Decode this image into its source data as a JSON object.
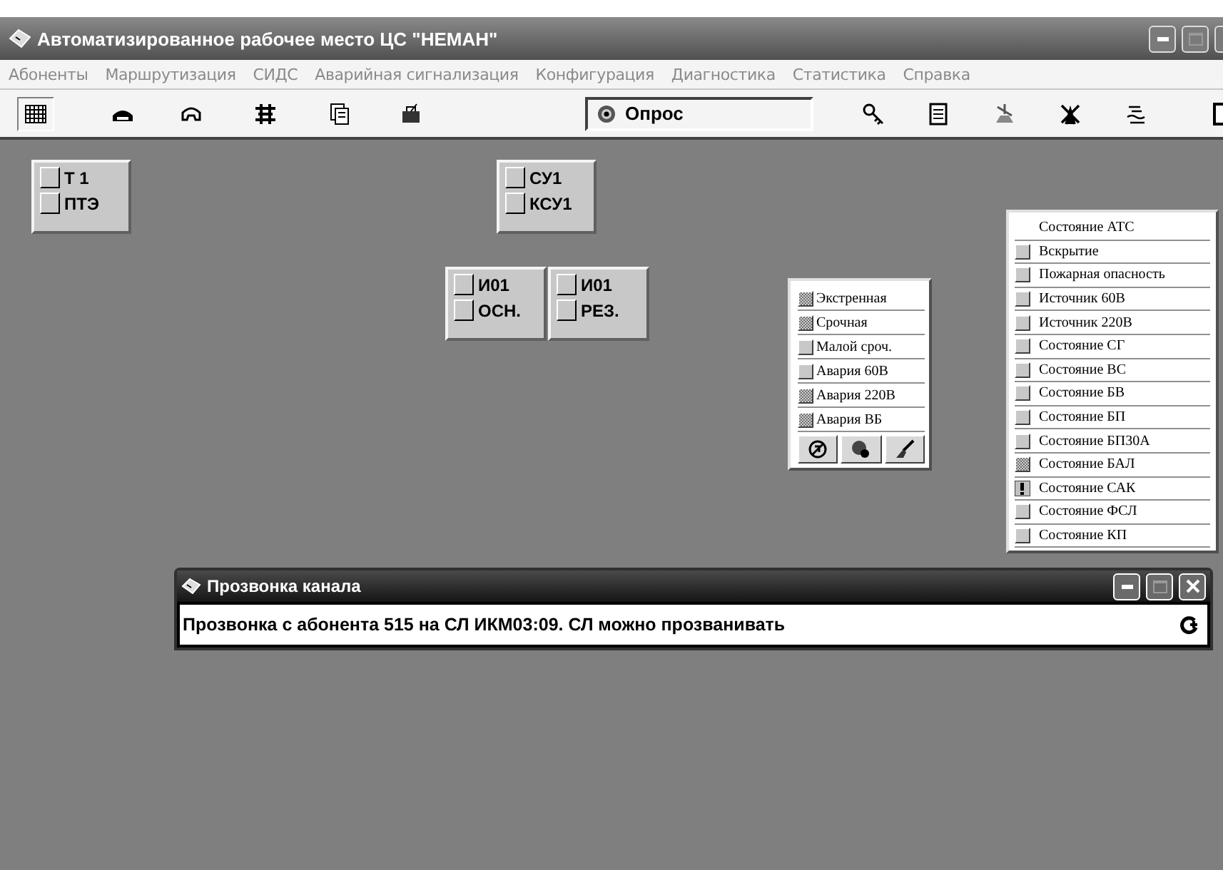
{
  "window": {
    "title": "Автоматизированное рабочее место ЦС \"НЕМАН\""
  },
  "menu": [
    "Абоненты",
    "Маршрутизация",
    "СИДС",
    "Аварийная сигнализация",
    "Конфигурация",
    "Диагностика",
    "Статистика",
    "Справка"
  ],
  "toolbar": {
    "poll_field": "Опрос"
  },
  "nodes": [
    {
      "lines": [
        "Т 1",
        "ПТЭ"
      ]
    },
    {
      "lines": [
        "СУ1",
        "КСУ1"
      ]
    },
    {
      "lines": [
        "И01",
        "ОСН."
      ]
    },
    {
      "lines": [
        "И01",
        "РЕЗ."
      ]
    }
  ],
  "alarm_panel": {
    "items": [
      {
        "label": "Экстренная",
        "kind": "pattern"
      },
      {
        "label": "Срочная",
        "kind": "pattern"
      },
      {
        "label": "Малой сроч.",
        "kind": "normal"
      },
      {
        "label": "Авария 60В",
        "kind": "normal"
      },
      {
        "label": "Авария 220В",
        "kind": "pattern"
      },
      {
        "label": "Авария ВБ",
        "kind": "pattern"
      }
    ]
  },
  "status_list": {
    "items": [
      {
        "label": "Состояние АТС",
        "kind": "none"
      },
      {
        "label": "Вскрытие",
        "kind": "normal"
      },
      {
        "label": "Пожарная опасность",
        "kind": "normal"
      },
      {
        "label": "Источник 60В",
        "kind": "normal"
      },
      {
        "label": "Источник 220В",
        "kind": "normal"
      },
      {
        "label": "Состояние СГ",
        "kind": "normal"
      },
      {
        "label": "Состояние ВС",
        "kind": "normal"
      },
      {
        "label": "Состояние БВ",
        "kind": "normal"
      },
      {
        "label": "Состояние БП",
        "kind": "normal"
      },
      {
        "label": "Состояние БП30А",
        "kind": "normal"
      },
      {
        "label": "Состояние БАЛ",
        "kind": "pattern"
      },
      {
        "label": "Состояние САК",
        "kind": "alarm"
      },
      {
        "label": "Состояние ФСЛ",
        "kind": "normal"
      },
      {
        "label": "Состояние КП",
        "kind": "normal"
      }
    ]
  },
  "dialog": {
    "title": "Прозвонка канала",
    "message": "Прозвонка с абонента 515 на СЛ ИКМ03:09. СЛ можно прозванивать"
  }
}
